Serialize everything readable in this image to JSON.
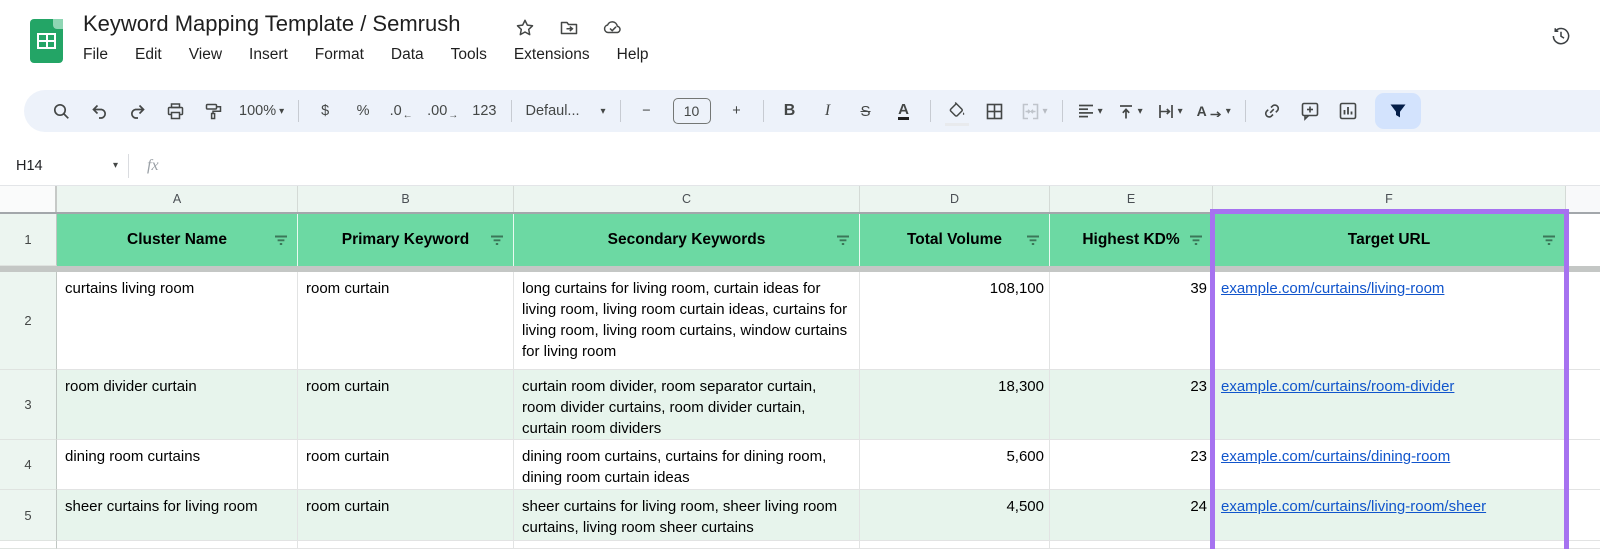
{
  "window": {
    "title": "Keyword Mapping Template / Semrush"
  },
  "menu": {
    "items": [
      "File",
      "Edit",
      "View",
      "Insert",
      "Format",
      "Data",
      "Tools",
      "Extensions",
      "Help"
    ]
  },
  "toolbar": {
    "zoom_value": "100%",
    "currency_label": "$",
    "percent_label": "%",
    "decrease_decimals_label": ".0",
    "decrease_decimals_arrow": "←",
    "increase_decimals_label": ".00",
    "increase_decimals_arrow": "→",
    "more_formats_label": "123",
    "font_name": "Defaul...",
    "decrease_font_label": "−",
    "font_size": "10",
    "increase_font_label": "+",
    "bold_label": "B",
    "italic_label": "I",
    "strikethrough_label": "S",
    "text_color_label": "A",
    "text_rotation_label": "A"
  },
  "formula_bar": {
    "cell_reference": "H14",
    "fx_label": "fx",
    "content": ""
  },
  "sheet": {
    "column_letters": [
      "A",
      "B",
      "C",
      "D",
      "E",
      "F"
    ],
    "header_row": {
      "row_number": "1",
      "cells": [
        "Cluster Name",
        "Primary Keyword",
        "Secondary Keywords",
        "Total Volume",
        "Highest KD%",
        "Target URL"
      ]
    },
    "rows": [
      {
        "row_number": "2",
        "cluster_name": "curtains living room",
        "primary_keyword": "room curtain",
        "secondary_keywords": "long curtains for living room, curtain ideas for living room, living room curtain ideas, curtains for living room, living room curtains, window curtains for living room",
        "total_volume": "108,100",
        "highest_kd": "39",
        "target_url": "example.com/curtains/living-room"
      },
      {
        "row_number": "3",
        "cluster_name": "room divider curtain",
        "primary_keyword": "room curtain",
        "secondary_keywords": "curtain room divider, room separator curtain, room divider curtains, room divider curtain, curtain room dividers",
        "total_volume": "18,300",
        "highest_kd": "23",
        "target_url": "example.com/curtains/room-divider"
      },
      {
        "row_number": "4",
        "cluster_name": "dining room curtains",
        "primary_keyword": "room curtain",
        "secondary_keywords": "dining room curtains, curtains for dining room, dining room curtain ideas",
        "total_volume": "5,600",
        "highest_kd": "23",
        "target_url": "example.com/curtains/dining-room"
      },
      {
        "row_number": "5",
        "cluster_name": "sheer curtains for living room",
        "primary_keyword": "room curtain",
        "secondary_keywords": "sheer curtains for living room, sheer living room curtains, living room sheer curtains",
        "total_volume": "4,500",
        "highest_kd": "24",
        "target_url": "example.com/curtains/living-room/sheer"
      }
    ]
  },
  "colors": {
    "header_fill": "#6cd9a3",
    "banding_fill": "#e7f4ec",
    "selection_purple": "#a672f0",
    "link_blue": "#1155cc",
    "logo_green": "#23a566",
    "toolbar_bg": "#edf2fa",
    "active_filter_chip_bg": "#d3e3fd"
  }
}
